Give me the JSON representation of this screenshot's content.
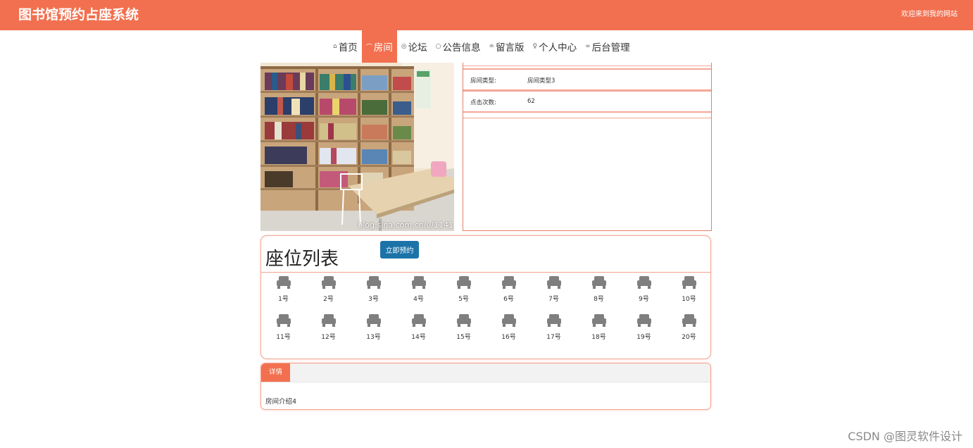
{
  "header": {
    "site_title": "图书馆预约占座系统",
    "welcome": "欢迎来到我的网站"
  },
  "nav": {
    "items": [
      {
        "label": "首页",
        "icon": "home-icon",
        "active": false
      },
      {
        "label": "房间",
        "icon": "room-icon",
        "active": true
      },
      {
        "label": "论坛",
        "icon": "forum-icon",
        "active": false
      },
      {
        "label": "公告信息",
        "icon": "notice-icon",
        "active": false
      },
      {
        "label": "留言版",
        "icon": "message-icon",
        "active": false
      },
      {
        "label": "个人中心",
        "icon": "user-icon",
        "active": false
      },
      {
        "label": "后台管理",
        "icon": "link-icon",
        "active": false
      }
    ]
  },
  "room": {
    "watermark": "blog.sina.com.cn/u/1141",
    "info": [
      {
        "label": "房间类型:",
        "value": "房间类型3"
      },
      {
        "label": "点击次数:",
        "value": "62"
      }
    ]
  },
  "seats": {
    "title": "座位列表",
    "book_button": "立即预约",
    "items": [
      "1号",
      "2号",
      "3号",
      "4号",
      "5号",
      "6号",
      "7号",
      "8号",
      "9号",
      "10号",
      "11号",
      "12号",
      "13号",
      "14号",
      "15号",
      "16号",
      "17号",
      "18号",
      "19号",
      "20号"
    ]
  },
  "details": {
    "tab_label": "详情",
    "content": "房间介绍4"
  },
  "footer": {
    "watermark": "CSDN @图灵软件设计"
  },
  "colors": {
    "accent": "#f2704f",
    "button": "#1b73a8"
  }
}
